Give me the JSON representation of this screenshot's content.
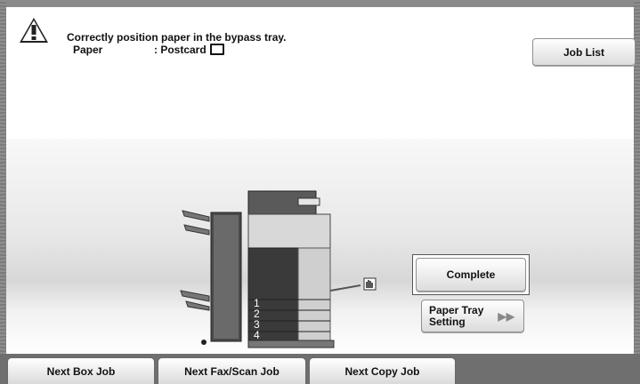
{
  "message": {
    "title": "Correctly position paper in the bypass tray.",
    "paper_label": "Paper",
    "paper_value": ": Postcard"
  },
  "header": {
    "job_list_label": "Job List"
  },
  "actions": {
    "complete_label": "Complete",
    "paper_tray_line1": "Paper Tray",
    "paper_tray_line2": "Setting"
  },
  "tray_numbers": [
    "1",
    "2",
    "3",
    "4"
  ],
  "bottom_tabs": [
    {
      "label": "Next Box Job"
    },
    {
      "label": "Next Fax/Scan Job"
    },
    {
      "label": "Next Copy Job"
    }
  ],
  "icons": {
    "warning": "warning-icon",
    "postcard": "postcard-icon",
    "forward": "double-chevron-right-icon",
    "hand": "hand-icon"
  },
  "colors": {
    "background": "#ffffff",
    "frame": "#6f6f6f",
    "button_top": "#ffffff",
    "button_bottom": "#dcdcdc"
  }
}
